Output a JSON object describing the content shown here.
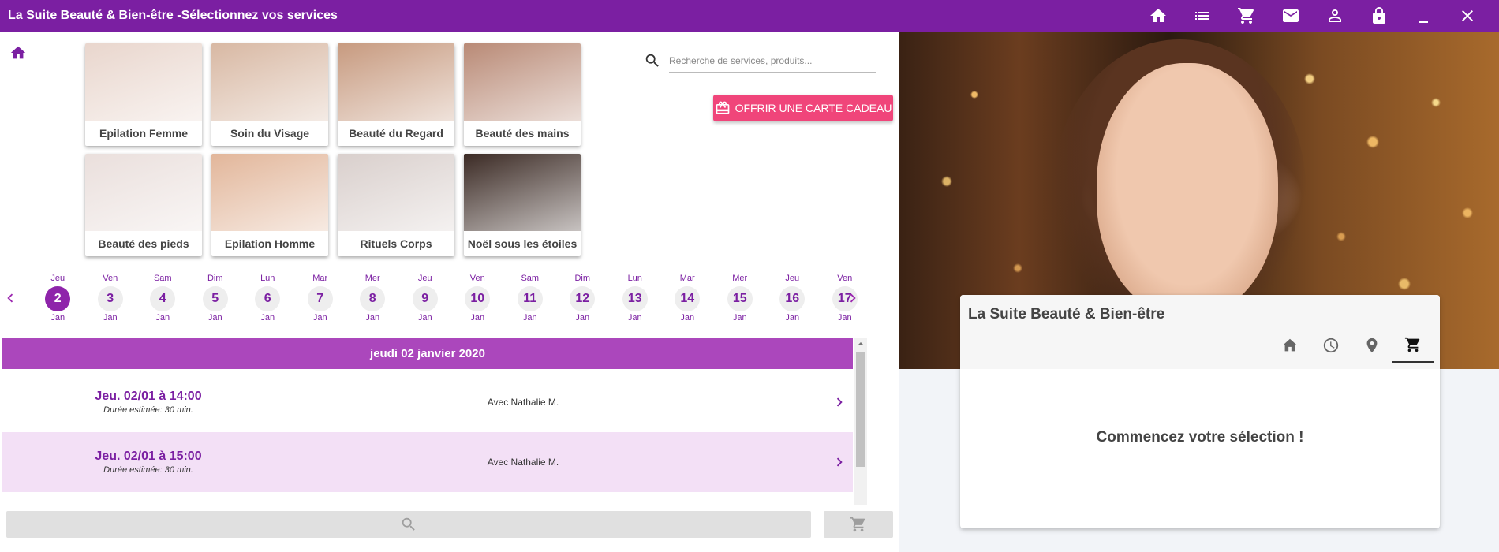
{
  "app": {
    "title": "La Suite Beauté & Bien-être -Sélectionnez vos services",
    "toolbar_icons": [
      "home-icon",
      "list-icon",
      "cart-icon",
      "mail-icon",
      "account-icon",
      "lock-icon",
      "minimize-icon",
      "close-icon"
    ]
  },
  "categories": [
    {
      "label": "Epilation Femme",
      "color": "#e9d6cd"
    },
    {
      "label": "Soin du Visage",
      "color": "#d8b8a3"
    },
    {
      "label": "Beauté du Regard",
      "color": "#c79a7f"
    },
    {
      "label": "Beauté des mains",
      "color": "#b98a76"
    },
    {
      "label": "Beauté des pieds",
      "color": "#eadfdc"
    },
    {
      "label": "Epilation Homme",
      "color": "#e2b69a"
    },
    {
      "label": "Rituels Corps",
      "color": "#d9cfcc"
    },
    {
      "label": "Noël sous les étoiles",
      "color": "#3b2a24"
    }
  ],
  "search": {
    "placeholder": "Recherche de services, produits..."
  },
  "gift": {
    "label": "OFFRIR UNE CARTE CADEAU",
    "color": "#f0457a"
  },
  "dates": [
    {
      "dow": "Jeu",
      "num": "2",
      "mon": "Jan",
      "selected": true
    },
    {
      "dow": "Ven",
      "num": "3",
      "mon": "Jan"
    },
    {
      "dow": "Sam",
      "num": "4",
      "mon": "Jan"
    },
    {
      "dow": "Dim",
      "num": "5",
      "mon": "Jan"
    },
    {
      "dow": "Lun",
      "num": "6",
      "mon": "Jan"
    },
    {
      "dow": "Mar",
      "num": "7",
      "mon": "Jan"
    },
    {
      "dow": "Mer",
      "num": "8",
      "mon": "Jan"
    },
    {
      "dow": "Jeu",
      "num": "9",
      "mon": "Jan"
    },
    {
      "dow": "Ven",
      "num": "10",
      "mon": "Jan"
    },
    {
      "dow": "Sam",
      "num": "11",
      "mon": "Jan"
    },
    {
      "dow": "Dim",
      "num": "12",
      "mon": "Jan"
    },
    {
      "dow": "Lun",
      "num": "13",
      "mon": "Jan"
    },
    {
      "dow": "Mar",
      "num": "14",
      "mon": "Jan"
    },
    {
      "dow": "Mer",
      "num": "15",
      "mon": "Jan"
    },
    {
      "dow": "Jeu",
      "num": "16",
      "mon": "Jan"
    },
    {
      "dow": "Ven",
      "num": "17",
      "mon": "Jan"
    }
  ],
  "slots": {
    "header": "jeudi 02 janvier 2020",
    "items": [
      {
        "time": "Jeu. 02/01 à 14:00",
        "duration": "Durée estimée: 30 min.",
        "staff": "Avec Nathalie M."
      },
      {
        "time": "Jeu. 02/01 à 15:00",
        "duration": "Durée estimée: 30 min.",
        "staff": "Avec Nathalie M."
      }
    ]
  },
  "salon": {
    "name": "La Suite Beauté & Bien-être",
    "tabs": [
      "home-icon",
      "clock-icon",
      "location-icon",
      "cart-icon"
    ],
    "active_tab": "cart-icon",
    "empty_text": "Commencez votre sélection !"
  },
  "colors": {
    "brand": "#7b1fa2",
    "accent": "#ab47bc",
    "selected_row": "#f3e0f6"
  }
}
